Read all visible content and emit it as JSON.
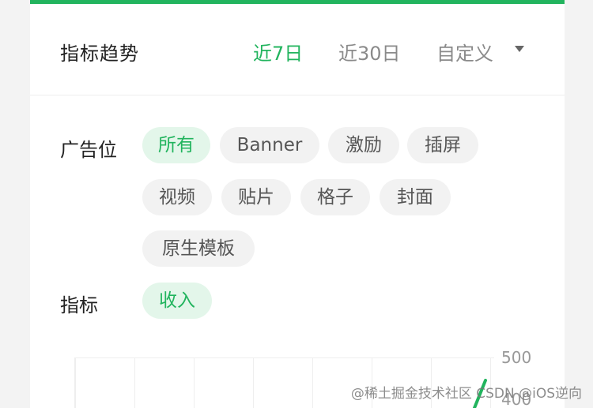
{
  "header": {
    "title": "指标趋势",
    "ranges": [
      "近7日",
      "近30日",
      "自定义"
    ]
  },
  "ad_slot": {
    "label": "广告位",
    "options": [
      "所有",
      "Banner",
      "激励",
      "插屏",
      "视频",
      "贴片",
      "格子",
      "封面",
      "原生模板"
    ]
  },
  "metric": {
    "label": "指标",
    "options": [
      "收入"
    ]
  },
  "chart": {
    "y_ticks": [
      "500",
      "400"
    ]
  },
  "watermark": "@稀土掘金技术社区 CSDN @iOS逆向",
  "colors": {
    "accent": "#22b45e",
    "chip_bg": "#f2f2f2",
    "chip_active_bg": "#e3f6ea"
  }
}
